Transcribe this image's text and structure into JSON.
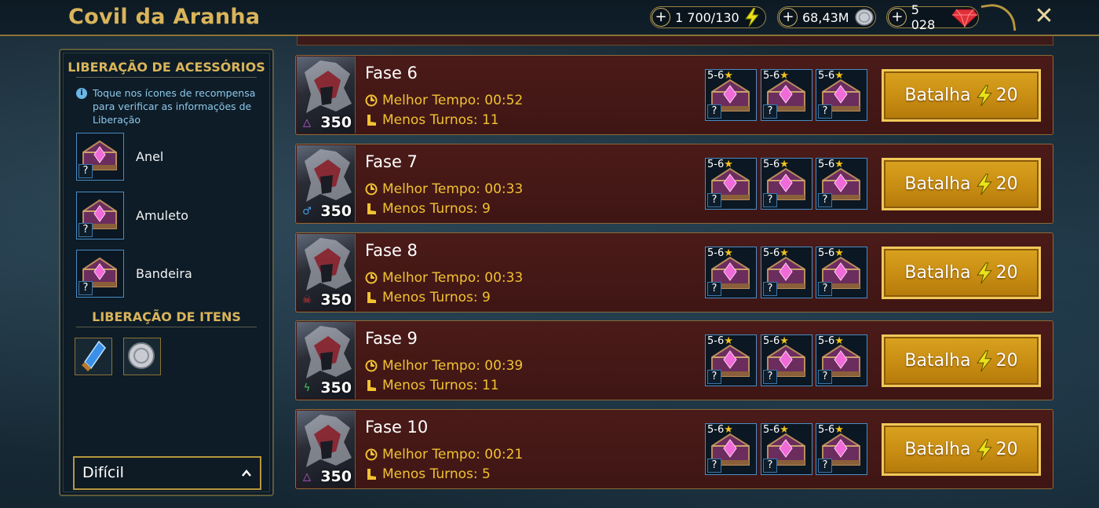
{
  "header": {
    "title": "Covil da Aranha",
    "resources": [
      {
        "name": "energy",
        "value": "1 700/130",
        "icon": "lightning-icon",
        "color": "#e9e21a"
      },
      {
        "name": "silver",
        "value": "68,43M",
        "icon": "silver-coin-icon",
        "color": "#c8ccd2"
      },
      {
        "name": "gems",
        "value": "5 028",
        "icon": "ruby-gem-icon",
        "color": "#e0303a"
      }
    ],
    "plus_label": "+",
    "close_label": "✕"
  },
  "left_panel": {
    "accessories_heading": "LIBERAÇÃO DE ACESSÓRIOS",
    "info_text": "Toque nos ícones de recompensa para verificar as informações de Liberação",
    "accessories": [
      {
        "label": "Anel"
      },
      {
        "label": "Amuleto"
      },
      {
        "label": "Bandeira"
      }
    ],
    "question_mark": "?",
    "items_heading": "LIBERAÇÃO DE ITENS",
    "items": [
      {
        "icon": "blue-crystal-icon"
      },
      {
        "icon": "silver-coin-icon"
      }
    ],
    "difficulty": "Difícil"
  },
  "stages": [
    {
      "name": "Fase 6",
      "best_time_label": "Melhor Tempo:",
      "best_time": "00:52",
      "turns_label": "Menos Turnos:",
      "turns": "11",
      "power": "350",
      "affinity": "magic",
      "affinity_color": "#c964e0"
    },
    {
      "name": "Fase 7",
      "best_time_label": "Melhor Tempo:",
      "best_time": "00:33",
      "turns_label": "Menos Turnos:",
      "turns": "9",
      "power": "350",
      "affinity": "force",
      "affinity_color": "#4a9fe3"
    },
    {
      "name": "Fase 8",
      "best_time_label": "Melhor Tempo:",
      "best_time": "00:33",
      "turns_label": "Menos Turnos:",
      "turns": "9",
      "power": "350",
      "affinity": "void",
      "affinity_color": "#e53535"
    },
    {
      "name": "Fase 9",
      "best_time_label": "Melhor Tempo:",
      "best_time": "00:39",
      "turns_label": "Menos Turnos:",
      "turns": "11",
      "power": "350",
      "affinity": "spirit",
      "affinity_color": "#3ed05a"
    },
    {
      "name": "Fase 10",
      "best_time_label": "Melhor Tempo:",
      "best_time": "00:21",
      "turns_label": "Menos Turnos:",
      "turns": "5",
      "power": "350",
      "affinity": "magic",
      "affinity_color": "#c964e0"
    }
  ],
  "reward_rank": "5-6",
  "reward_star": "★",
  "battle": {
    "label": "Batalha",
    "cost": "20"
  }
}
